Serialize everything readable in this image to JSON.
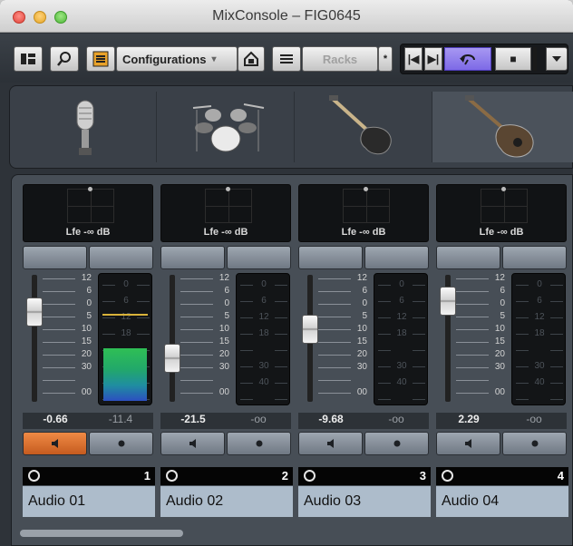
{
  "window": {
    "title": "MixConsole – FIG0645"
  },
  "toolbar": {
    "configurations_label": "Configurations",
    "racks_label": "Racks",
    "racks_star": "*",
    "icons": [
      "channel-visibility-icon",
      "search-icon",
      "channel-list-icon",
      "snapshot-icon",
      "racks-menu-icon"
    ],
    "transport": {
      "prev": "|◀",
      "next": "▶|",
      "stop": "■",
      "cycle_active": true
    }
  },
  "strip_icons": [
    "microphone-icon",
    "drums-icon",
    "electric-guitar-icon",
    "acoustic-guitar-icon"
  ],
  "channels": [
    {
      "panner_label": "Lfe -∞ dB",
      "fader_value": "-0.66",
      "meter_value": "-11.4",
      "number": "1",
      "name": "Audio 01",
      "mute_active": true
    },
    {
      "panner_label": "Lfe -∞ dB",
      "fader_value": "-21.5",
      "meter_value": "-oo",
      "number": "2",
      "name": "Audio 02",
      "mute_active": false
    },
    {
      "panner_label": "Lfe -∞ dB",
      "fader_value": "-9.68",
      "meter_value": "-oo",
      "number": "3",
      "name": "Audio 03",
      "mute_active": false
    },
    {
      "panner_label": "Lfe -∞ dB",
      "fader_value": "2.29",
      "meter_value": "-oo",
      "number": "4",
      "name": "Audio 04",
      "mute_active": false
    }
  ],
  "fader_scale": [
    "12",
    "6",
    "0",
    "5",
    "10",
    "15",
    "20",
    "30",
    "",
    "00"
  ],
  "meter_scale": [
    "0",
    "6",
    "12",
    "18",
    "",
    "30",
    "40",
    ""
  ],
  "colors": {
    "mute_active": "#e07a35",
    "meter_green": "#2fbf55",
    "meter_blue": "#2c4fc0",
    "name_bg": "#adbccb"
  }
}
